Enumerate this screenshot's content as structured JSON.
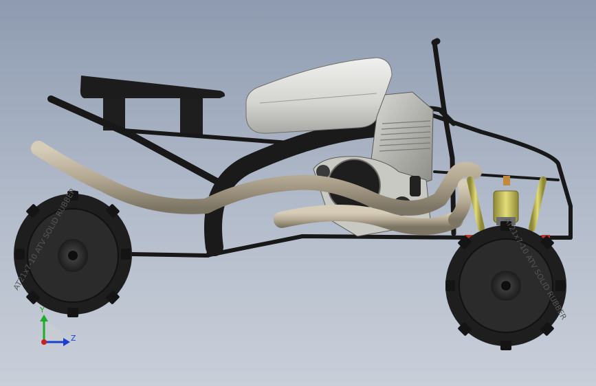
{
  "viewport": {
    "background_top": "#8e9bb0",
    "background_bottom": "#c9cfd9"
  },
  "model": {
    "frame_color": "#1a1a1a",
    "exhaust_color": "#b7ad9a",
    "tank_color": "#d6d6d2",
    "engine_color": "#a9a9a4",
    "shock_color": "#c8c04a",
    "tire_color": "#2a2a2a",
    "front_tire_text": "AT21x7-10 ATV SOLID RUBBER",
    "rear_tire_text": "AT21x7-10 ATV SOLID RUBBER"
  },
  "triad": {
    "y_label": "Y",
    "z_label": "Z",
    "y_color": "#1faa2a",
    "z_color": "#1a3fd0",
    "x_color": "#cc1f1f"
  }
}
